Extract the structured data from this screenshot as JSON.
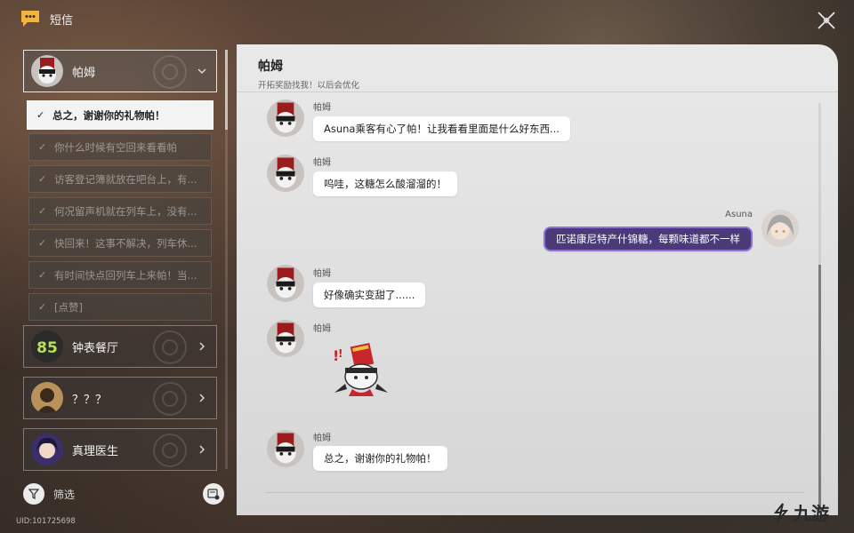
{
  "app": {
    "title": "短信",
    "uid": "UID:101725698"
  },
  "sidebar": {
    "active_contact": {
      "name": "帕姆"
    },
    "threads": [
      {
        "label": "总之，谢谢你的礼物帕！",
        "selected": true
      },
      {
        "label": "你什么时候有空回来看看帕",
        "selected": false
      },
      {
        "label": "访客登记簿就放在吧台上，有...",
        "selected": false
      },
      {
        "label": "何况留声机就在列车上，没有...",
        "selected": false
      },
      {
        "label": "快回来！这事不解决，列车休...",
        "selected": false
      },
      {
        "label": "有时间快点回列车上来帕！当...",
        "selected": false
      },
      {
        "label": "[点赞]",
        "selected": false
      }
    ],
    "contacts": [
      {
        "name": "钟表餐厅"
      },
      {
        "name": "？？？"
      },
      {
        "name": "真理医生"
      }
    ],
    "filter_label": "筛选"
  },
  "chat": {
    "title": "帕姆",
    "subtitle": "开拓奖励找我！以后会优化",
    "messages": [
      {
        "sender": "帕姆",
        "text": "Asuna乘客有心了帕！让我看看里面是什么好东西...",
        "mine": false
      },
      {
        "sender": "帕姆",
        "text": "呜哇，这糖怎么酸溜溜的！",
        "mine": false
      },
      {
        "sender": "Asuna",
        "text": "匹诺康尼特产什锦糖，每颗味道都不一样",
        "mine": true
      },
      {
        "sender": "帕姆",
        "text": "好像确实变甜了......",
        "mine": false
      },
      {
        "sender": "帕姆",
        "text": "",
        "mine": false,
        "sticker": true
      },
      {
        "sender": "帕姆",
        "text": "总之，谢谢你的礼物帕！",
        "mine": false
      }
    ]
  },
  "watermark": {
    "text": "九游"
  },
  "colors": {
    "accent_purple": "#8f6fd9",
    "panel_bg": "#e4e4e4",
    "selected_thread_bg": "#f3f3f3"
  },
  "icons": [
    "chat-bubble-icon",
    "close-icon",
    "chevron-down-icon",
    "chevron-right-icon",
    "check-icon",
    "filter-icon",
    "settings-icon"
  ]
}
